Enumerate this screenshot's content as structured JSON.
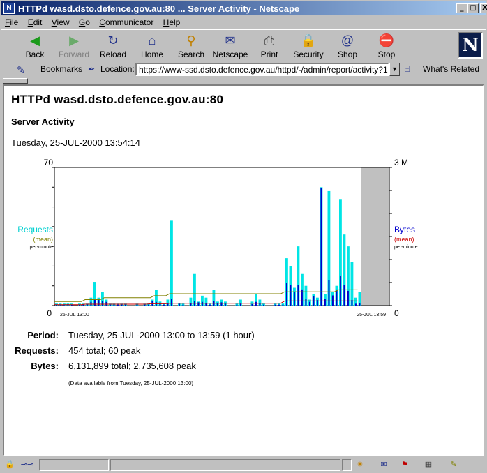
{
  "window": {
    "title": "HTTPd wasd.dsto.defence.gov.au:80 ... Server Activity - Netscape",
    "minimize": "_",
    "maximize": "□",
    "close": "X"
  },
  "menu": [
    "File",
    "Edit",
    "View",
    "Go",
    "Communicator",
    "Help"
  ],
  "toolbar": [
    {
      "label": "Back",
      "icon": "back-icon",
      "glyph": "◀",
      "color": "#1a9a1a",
      "enabled": true
    },
    {
      "label": "Forward",
      "icon": "forward-icon",
      "glyph": "▶",
      "color": "#6aaa6a",
      "enabled": false
    },
    {
      "label": "Reload",
      "icon": "reload-icon",
      "glyph": "↻",
      "color": "#20308a",
      "enabled": true
    },
    {
      "label": "Home",
      "icon": "home-icon",
      "glyph": "⌂",
      "color": "#20308a",
      "enabled": true
    },
    {
      "label": "Search",
      "icon": "search-icon",
      "glyph": "⚲",
      "color": "#c08000",
      "enabled": true
    },
    {
      "label": "Netscape",
      "icon": "netscape-icon",
      "glyph": "✉",
      "color": "#20308a",
      "enabled": true
    },
    {
      "label": "Print",
      "icon": "print-icon",
      "glyph": "⎙",
      "color": "#404040",
      "enabled": true
    },
    {
      "label": "Security",
      "icon": "lock-icon",
      "glyph": "🔒",
      "color": "#c0a000",
      "enabled": true
    },
    {
      "label": "Shop",
      "icon": "shop-icon",
      "glyph": "@",
      "color": "#20308a",
      "enabled": true
    },
    {
      "label": "Stop",
      "icon": "stop-icon",
      "glyph": "⛔",
      "color": "#c00000",
      "enabled": true
    }
  ],
  "location": {
    "bookmarks_label": "Bookmarks",
    "location_label": "Location:",
    "url": "https://www-ssd.dsto.defence.gov.au/httpd/-/admin/report/activity?1",
    "whats_related": "What's Related"
  },
  "page": {
    "title": "HTTPd wasd.dsto.defence.gov.au:80",
    "subtitle": "Server Activity",
    "date": "Tuesday, 25-JUL-2000 13:54:14",
    "stats": [
      {
        "key": "Period:",
        "value": "Tuesday, 25-JUL-2000 13:00 to 13:59  (1 hour)"
      },
      {
        "key": "Requests:",
        "value": "454 total;  60 peak"
      },
      {
        "key": "Bytes:",
        "value": "6,131,899 total;  2,735,608 peak"
      }
    ],
    "note": "(Data available from Tuesday, 25-JUL-2000 13:00)"
  },
  "chart_data": {
    "type": "bar",
    "left_axis": {
      "max_label": "70",
      "min_label": "0",
      "label": "Requests",
      "sub1": "(mean)",
      "sub2": "per-minute",
      "color": "#00e5e5",
      "ylim": [
        0,
        70
      ]
    },
    "right_axis": {
      "max_label": "3 M",
      "min_label": "0",
      "label": "Bytes",
      "sub1": "(mean)",
      "sub2": "per-minute",
      "color": "#0000cc",
      "ylim": [
        0,
        3
      ]
    },
    "x_start": "25-JUL 13:00",
    "x_end": "25-JUL 13:59",
    "minutes_shown": 55,
    "minutes_total": 60,
    "requests": [
      1,
      1,
      1,
      1,
      1,
      0,
      1,
      1,
      1,
      4,
      12,
      4,
      7,
      3,
      1,
      1,
      1,
      1,
      1,
      0,
      0,
      1,
      0,
      1,
      1,
      3,
      8,
      2,
      1,
      3,
      43,
      0,
      1,
      1,
      0,
      4,
      16,
      2,
      5,
      4,
      1,
      8,
      2,
      3,
      2,
      0,
      0,
      1,
      3,
      0,
      0,
      2,
      6,
      3,
      1,
      0,
      0,
      1,
      1,
      1,
      24,
      20,
      9,
      30,
      16,
      10,
      3,
      6,
      4,
      60,
      6,
      58,
      7,
      10,
      54,
      36,
      30,
      22,
      4,
      7
    ],
    "bytes": [
      0.02,
      0.01,
      0.01,
      0.03,
      0.02,
      0,
      0.02,
      0.02,
      0.03,
      0.08,
      0.15,
      0.12,
      0.1,
      0.08,
      0.02,
      0.02,
      0.02,
      0.02,
      0.02,
      0,
      0,
      0.02,
      0,
      0.02,
      0.02,
      0.1,
      0.08,
      0.06,
      0.02,
      0.05,
      0.15,
      0,
      0.04,
      0.02,
      0,
      0.05,
      0.1,
      0.07,
      0.08,
      0.06,
      0.02,
      0.1,
      0.05,
      0.07,
      0.04,
      0,
      0,
      0.02,
      0.04,
      0,
      0,
      0.03,
      0.08,
      0.05,
      0.02,
      0,
      0,
      0.02,
      0.02,
      0.02,
      0.5,
      0.45,
      0.3,
      0.45,
      0.35,
      0.15,
      0.08,
      0.2,
      0.12,
      2.55,
      0.15,
      0.55,
      0.22,
      0.35,
      0.65,
      0.45,
      0.32,
      0.12,
      0.04,
      0.05
    ],
    "mean_requests_line": [
      2,
      2,
      2,
      2,
      2,
      2,
      2,
      2,
      3,
      3,
      3,
      3,
      3,
      4,
      4,
      4,
      4,
      4,
      4,
      4,
      4,
      4,
      4,
      4,
      4,
      4,
      5,
      5,
      5,
      5,
      6,
      6,
      6,
      6,
      6,
      6,
      6,
      6,
      6,
      6,
      6,
      6,
      6,
      6,
      6,
      6,
      6,
      6,
      6,
      6,
      6,
      6,
      6,
      6,
      6,
      6,
      6,
      6,
      6,
      6,
      7,
      7,
      7,
      7,
      7,
      7,
      7,
      7,
      7,
      7,
      7,
      7,
      7,
      7,
      8,
      8,
      8,
      8,
      8,
      8
    ],
    "mean_bytes_line": [
      0.02,
      0.02,
      0.02,
      0.02,
      0.02,
      0.02,
      0.02,
      0.02,
      0.03,
      0.03,
      0.03,
      0.03,
      0.03,
      0.03,
      0.03,
      0.03,
      0.03,
      0.03,
      0.03,
      0.03,
      0.03,
      0.03,
      0.03,
      0.03,
      0.03,
      0.04,
      0.04,
      0.04,
      0.04,
      0.04,
      0.05,
      0.05,
      0.05,
      0.05,
      0.05,
      0.05,
      0.05,
      0.05,
      0.05,
      0.05,
      0.05,
      0.05,
      0.05,
      0.05,
      0.05,
      0.05,
      0.05,
      0.05,
      0.05,
      0.05,
      0.05,
      0.05,
      0.05,
      0.05,
      0.05,
      0.05,
      0.05,
      0.05,
      0.05,
      0.05,
      0.1,
      0.1,
      0.1,
      0.1,
      0.1,
      0.1,
      0.1,
      0.1,
      0.1,
      0.1,
      0.1,
      0.1,
      0.1,
      0.1,
      0.1,
      0.1,
      0.1,
      0.1,
      0.1,
      0.1
    ],
    "mean_requests_color": "#808000",
    "mean_bytes_color": "#cc0000",
    "future_color": "#c0c0c0"
  }
}
